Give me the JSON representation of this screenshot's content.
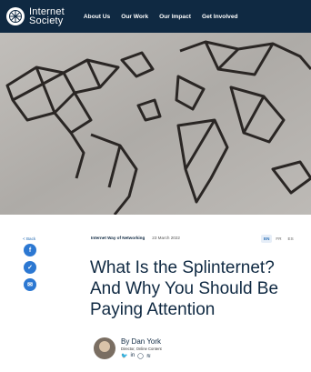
{
  "header": {
    "logo_line1": "Internet",
    "logo_line2": "Society",
    "nav": [
      "About Us",
      "Our Work",
      "Our Impact",
      "Get Involved"
    ]
  },
  "sidebar": {
    "back_label": "< Back",
    "share_icons": [
      "facebook-icon",
      "twitter-icon",
      "email-icon"
    ]
  },
  "article": {
    "category": "Internet Way of Networking",
    "date": "23 March 2022",
    "languages": [
      "EN",
      "FR",
      "ES"
    ],
    "active_language": "EN",
    "title": "What Is the Splinternet? And Why You Should Be Paying Attention",
    "author": {
      "name": "By Dan York",
      "role": "Director, Online Content",
      "social_icons": [
        "twitter-icon",
        "linkedin-icon",
        "github-icon",
        "rss-icon"
      ]
    }
  },
  "colors": {
    "header_bg": "#0f2942",
    "accent": "#2c78d2",
    "hero_bg": "#b4b1ad"
  }
}
